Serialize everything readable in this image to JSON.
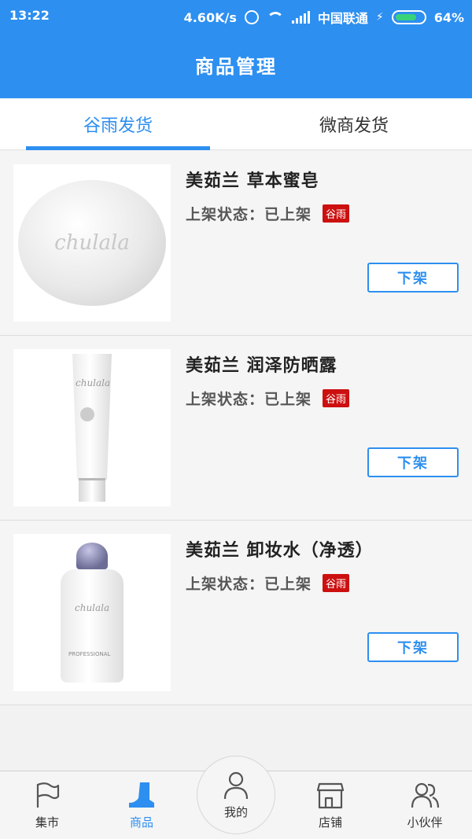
{
  "status_bar": {
    "time": "13:22",
    "speed": "4.60K/s",
    "carrier": "中国联通",
    "battery": "64%"
  },
  "header": {
    "title": "商品管理"
  },
  "tabs": [
    {
      "label": "谷雨发货",
      "active": true
    },
    {
      "label": "微商发货",
      "active": false
    }
  ],
  "products": [
    {
      "name": "美茹兰 草本蜜皂",
      "status": "上架状态：已上架",
      "badge": "谷雨",
      "button": "下架",
      "image": "soap",
      "image_text": "chulala"
    },
    {
      "name": "美茹兰 润泽防晒露",
      "status": "上架状态：已上架",
      "badge": "谷雨",
      "button": "下架",
      "image": "sunscreen-tube",
      "image_text": "chulala"
    },
    {
      "name": "美茹兰 卸妆水（净透）",
      "status": "上架状态：已上架",
      "badge": "谷雨",
      "button": "下架",
      "image": "cleansing-bottle",
      "image_text": "chulala"
    }
  ],
  "bottom_nav": [
    {
      "label": "集市",
      "icon": "flag-icon",
      "active": false
    },
    {
      "label": "商品",
      "icon": "boot-icon",
      "active": true
    },
    {
      "label": "我的",
      "icon": "person-icon",
      "active": false
    },
    {
      "label": "店铺",
      "icon": "store-icon",
      "active": false
    },
    {
      "label": "小伙伴",
      "icon": "friends-icon",
      "active": false
    }
  ],
  "colors": {
    "primary": "#2d8ff0",
    "badge": "#cc1010"
  }
}
